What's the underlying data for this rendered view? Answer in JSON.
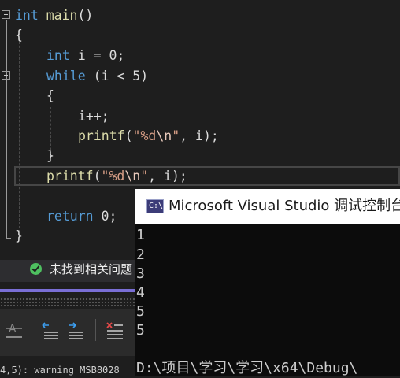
{
  "editor": {
    "lines": [
      {
        "parts": [
          {
            "t": "int",
            "c": "kw"
          },
          {
            "t": " "
          },
          {
            "t": "main",
            "c": "fn"
          },
          {
            "t": "()"
          }
        ]
      },
      {
        "parts": [
          {
            "t": "{"
          }
        ]
      },
      {
        "parts": [
          {
            "t": "int",
            "c": "kw"
          },
          {
            "t": " i = 0;"
          }
        ]
      },
      {
        "parts": [
          {
            "t": "while",
            "c": "kw"
          },
          {
            "t": " (i < 5)"
          }
        ]
      },
      {
        "parts": [
          {
            "t": "{"
          }
        ]
      },
      {
        "parts": [
          {
            "t": "i++;"
          }
        ]
      },
      {
        "parts": [
          {
            "t": "printf",
            "c": "fn"
          },
          {
            "t": "("
          },
          {
            "t": "\"%d",
            "c": "str"
          },
          {
            "t": "\\n",
            "c": "esc"
          },
          {
            "t": "\"",
            "c": "str"
          },
          {
            "t": ", i);"
          }
        ]
      },
      {
        "parts": [
          {
            "t": "}"
          }
        ]
      },
      {
        "parts": [
          {
            "t": "printf",
            "c": "fn"
          },
          {
            "t": "("
          },
          {
            "t": "\"%d",
            "c": "str"
          },
          {
            "t": "\\n",
            "c": "esc"
          },
          {
            "t": "\"",
            "c": "str"
          },
          {
            "t": ", i);"
          }
        ]
      },
      {
        "parts": [
          {
            "t": "return",
            "c": "kw"
          },
          {
            "t": " 0;"
          }
        ]
      },
      {
        "parts": [
          {
            "t": "}"
          }
        ]
      }
    ]
  },
  "status": {
    "message": "未找到相关问题",
    "icon": "check-circle-icon"
  },
  "toolbar": {
    "buttons": [
      "strikethrough-icon",
      "outdent-icon",
      "indent-icon",
      "remove-breakpoints-icon"
    ]
  },
  "output_panel": {
    "text": "4,5): warning MSB8028"
  },
  "console": {
    "title": "Microsoft Visual Studio 调试控制台",
    "icon_text": "C:\\",
    "output": [
      "1",
      "2",
      "3",
      "4",
      "5",
      "5",
      "",
      "D:\\项目\\学习\\学习\\x64\\Debug\\"
    ]
  },
  "colors": {
    "keyword": "#569cd6",
    "function": "#dcdcaa",
    "string": "#d69d85",
    "accent": "#7a6fd6",
    "success": "#4ec060"
  }
}
